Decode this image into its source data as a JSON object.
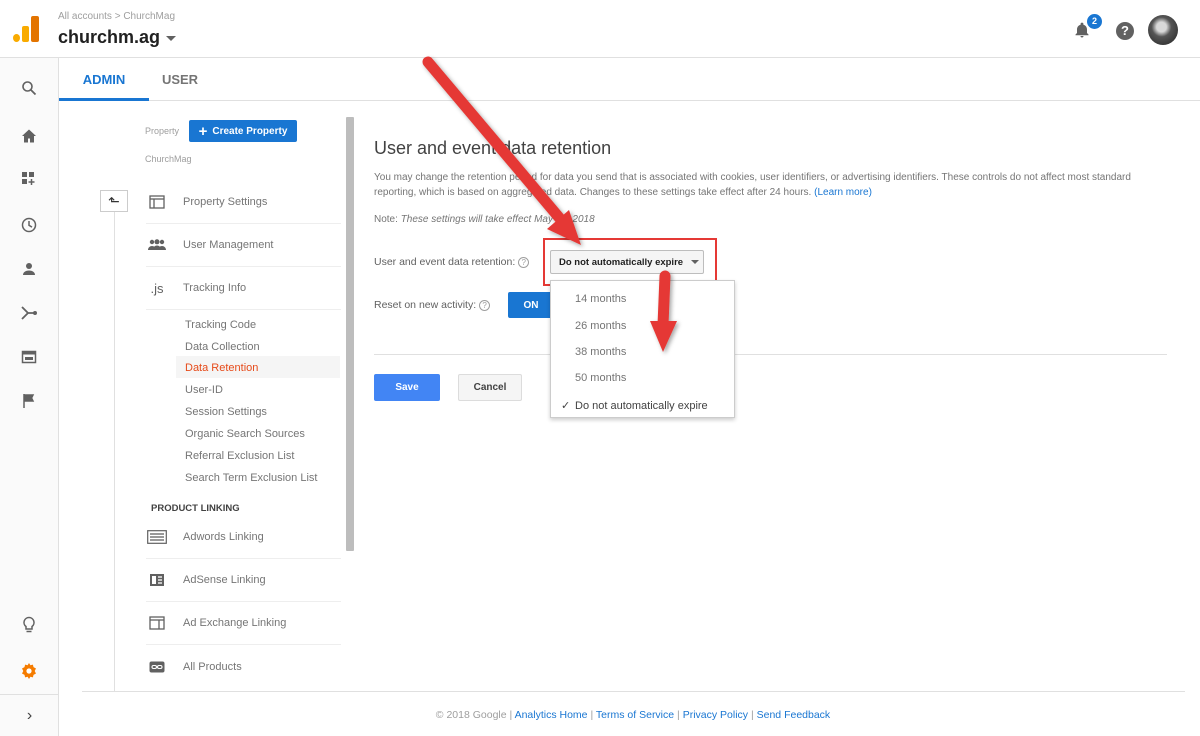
{
  "header": {
    "breadcrumb": "All accounts > ChurchMag",
    "account_name": "churchm.ag",
    "notification_count": "2",
    "help_label": "?"
  },
  "tabs": {
    "admin": "ADMIN",
    "user": "USER"
  },
  "property": {
    "label": "Property",
    "create_button": "Create Property",
    "name": "ChurchMag",
    "back_label": "⬑",
    "nav": {
      "property_settings": "Property Settings",
      "user_management": "User Management",
      "tracking_info": "Tracking Info",
      "tracking_icon": ".js"
    },
    "tracking_sub": [
      "Tracking Code",
      "Data Collection",
      "Data Retention",
      "User-ID",
      "Session Settings",
      "Organic Search Sources",
      "Referral Exclusion List",
      "Search Term Exclusion List"
    ],
    "product_linking_header": "PRODUCT LINKING",
    "product_links": [
      "Adwords Linking",
      "AdSense Linking",
      "Ad Exchange Linking",
      "All Products"
    ]
  },
  "main": {
    "title": "User and event data retention",
    "description": "You may change the retention period for data you send that is associated with cookies, user identifiers, or advertising identifiers. These controls do not affect most standard reporting, which is based on aggregated data. Changes to these settings take effect after 24 hours.",
    "learn_more": "(Learn more)",
    "note_label": "Note:",
    "note_text": "These settings will take effect May 25, 2018",
    "retention_label": "User and event data retention:",
    "retention_value": "Do not automatically expire",
    "reset_label": "Reset on new activity:",
    "reset_toggle": "ON",
    "save": "Save",
    "cancel": "Cancel",
    "dropdown_options": [
      "14 months",
      "26 months",
      "38 months",
      "50 months",
      "Do not automatically expire"
    ],
    "selected_option_index": 4
  },
  "footer": {
    "copyright": "© 2018 Google |",
    "analytics_home": "Analytics Home",
    "sep1": "|",
    "terms": "Terms of Service",
    "sep2": "|",
    "privacy": "Privacy Policy",
    "sep3": "|",
    "feedback": "Send Feedback"
  },
  "colors": {
    "accent": "#1976d2",
    "annotation_red": "#e53935",
    "active_item": "#e64a19",
    "settings_orange": "#f57c00"
  }
}
